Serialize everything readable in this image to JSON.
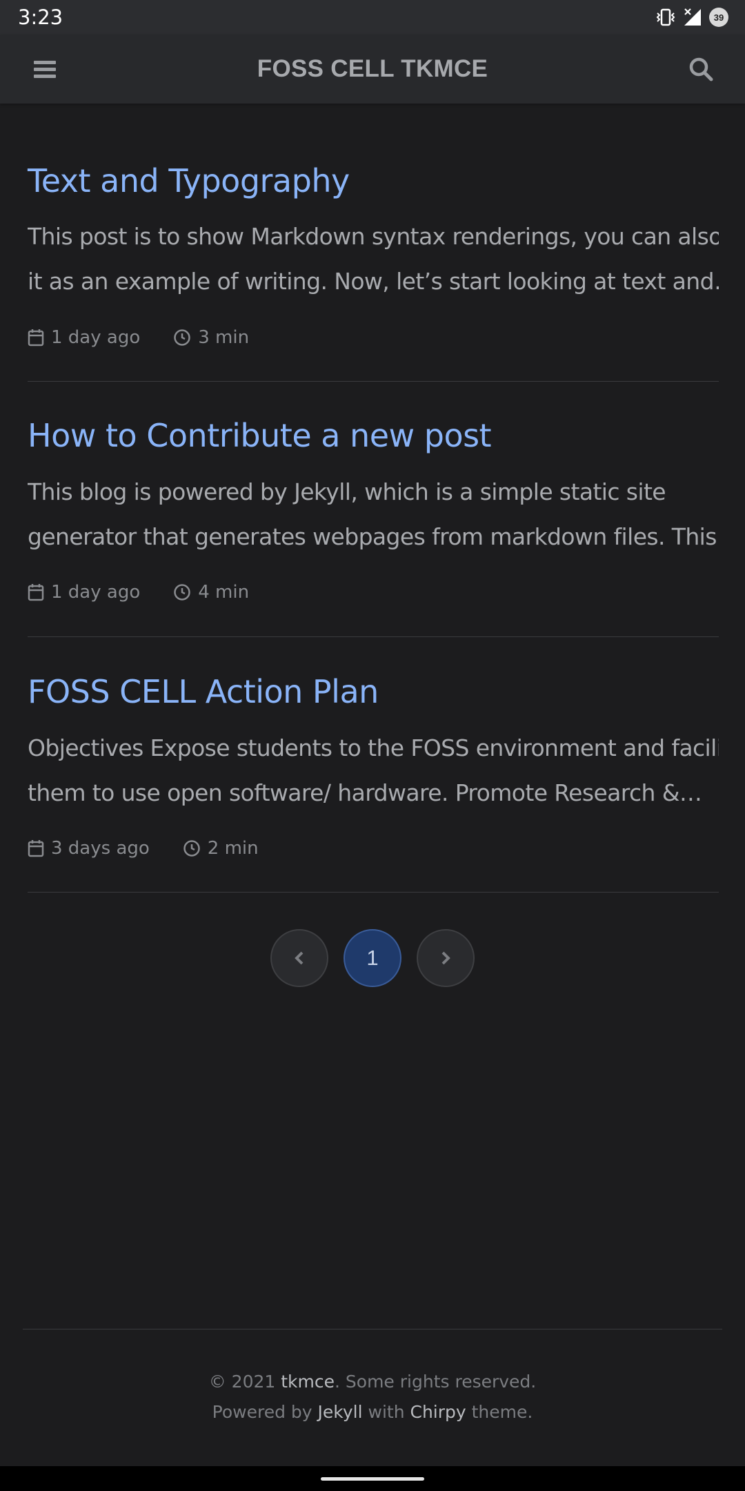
{
  "status_bar": {
    "time": "3:23",
    "battery": "39"
  },
  "header": {
    "title": "FOSS CELL TKMCE",
    "menu_icon": "hamburger-icon",
    "search_icon": "search-icon"
  },
  "posts": [
    {
      "title": "Text and Typography",
      "excerpt_lines": [
        "This post is to show Markdown syntax renderings, you can also use",
        "it as an example of writing. Now, let’s start looking at text and…"
      ],
      "date": "1 day ago",
      "read_time": "3 min"
    },
    {
      "title": "How to Contribute a new post",
      "excerpt_lines": [
        "This blog is powered by Jekyll, which is a simple static site",
        "generator that generates webpages from markdown files. This…"
      ],
      "date": "1 day ago",
      "read_time": "4 min"
    },
    {
      "title": "FOSS CELL Action Plan",
      "excerpt_lines": [
        "Objectives Expose students to the FOSS environment and facilitate",
        "them to use open software/ hardware. Promote Research &…"
      ],
      "date": "3 days ago",
      "read_time": "2 min"
    }
  ],
  "pagination": {
    "prev_icon": "chevron-left-icon",
    "current": "1",
    "next_icon": "chevron-right-icon"
  },
  "footer": {
    "copyright_prefix": "© 2021 ",
    "copyright_owner": "tkmce",
    "copyright_suffix": ". Some rights reserved.",
    "powered_prefix": "Powered by ",
    "powered_engine": "Jekyll",
    "powered_with": " with ",
    "powered_theme": "Chirpy",
    "powered_suffix": " theme."
  },
  "colors": {
    "accent_link": "#8ab4f8",
    "background": "#1c1c1e",
    "active_page": "#1f3a6b"
  }
}
